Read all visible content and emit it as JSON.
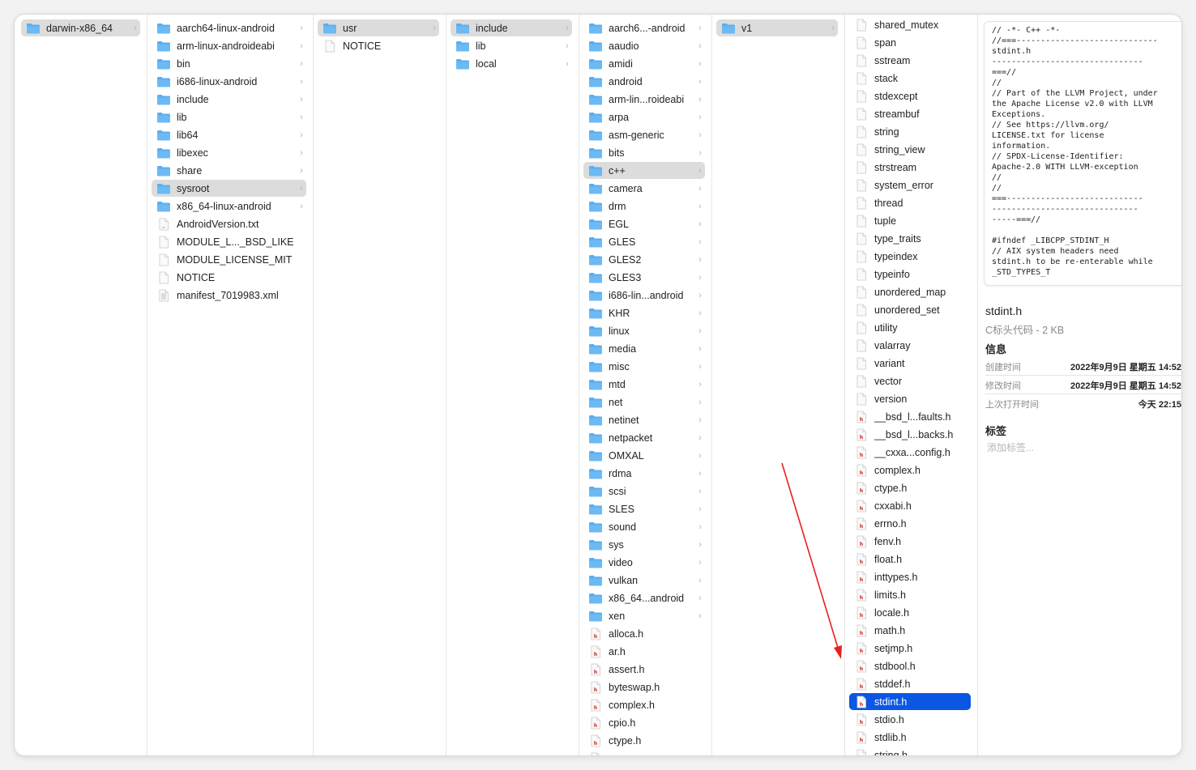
{
  "colors": {
    "selection_active": "#0b57e3",
    "selection_inactive": "#dcdcdc",
    "folder": "#5aaef0",
    "arrow": "#e8201c"
  },
  "columns": [
    {
      "items": [
        {
          "name": "darwin-x86_64",
          "type": "folder",
          "chevron": true,
          "selected": "gray"
        }
      ]
    },
    {
      "items": [
        {
          "name": "aarch64-linux-android",
          "type": "folder",
          "chevron": true
        },
        {
          "name": "arm-linux-androideabi",
          "type": "folder",
          "chevron": true
        },
        {
          "name": "bin",
          "type": "folder",
          "chevron": true
        },
        {
          "name": "i686-linux-android",
          "type": "folder",
          "chevron": true
        },
        {
          "name": "include",
          "type": "folder",
          "chevron": true
        },
        {
          "name": "lib",
          "type": "folder",
          "chevron": true
        },
        {
          "name": "lib64",
          "type": "folder",
          "chevron": true
        },
        {
          "name": "libexec",
          "type": "folder",
          "chevron": true
        },
        {
          "name": "share",
          "type": "folder",
          "chevron": true
        },
        {
          "name": "sysroot",
          "type": "folder",
          "chevron": true,
          "selected": "gray"
        },
        {
          "name": "x86_64-linux-android",
          "type": "folder",
          "chevron": true
        },
        {
          "name": "AndroidVersion.txt",
          "type": "txt"
        },
        {
          "name": "MODULE_L..._BSD_LIKE",
          "type": "file"
        },
        {
          "name": "MODULE_LICENSE_MIT",
          "type": "file"
        },
        {
          "name": "NOTICE",
          "type": "file"
        },
        {
          "name": "manifest_7019983.xml",
          "type": "xml"
        }
      ]
    },
    {
      "items": [
        {
          "name": "usr",
          "type": "folder",
          "chevron": true,
          "selected": "gray"
        },
        {
          "name": "NOTICE",
          "type": "file"
        }
      ]
    },
    {
      "items": [
        {
          "name": "include",
          "type": "folder",
          "chevron": true,
          "selected": "gray"
        },
        {
          "name": "lib",
          "type": "folder",
          "chevron": true
        },
        {
          "name": "local",
          "type": "folder",
          "chevron": true
        }
      ]
    },
    {
      "items": [
        {
          "name": "aarch6...-android",
          "type": "folder",
          "chevron": true
        },
        {
          "name": "aaudio",
          "type": "folder",
          "chevron": true
        },
        {
          "name": "amidi",
          "type": "folder",
          "chevron": true
        },
        {
          "name": "android",
          "type": "folder",
          "chevron": true
        },
        {
          "name": "arm-lin...roideabi",
          "type": "folder",
          "chevron": true
        },
        {
          "name": "arpa",
          "type": "folder",
          "chevron": true
        },
        {
          "name": "asm-generic",
          "type": "folder",
          "chevron": true
        },
        {
          "name": "bits",
          "type": "folder",
          "chevron": true
        },
        {
          "name": "c++",
          "type": "folder",
          "chevron": true,
          "selected": "gray"
        },
        {
          "name": "camera",
          "type": "folder",
          "chevron": true
        },
        {
          "name": "drm",
          "type": "folder",
          "chevron": true
        },
        {
          "name": "EGL",
          "type": "folder",
          "chevron": true
        },
        {
          "name": "GLES",
          "type": "folder",
          "chevron": true
        },
        {
          "name": "GLES2",
          "type": "folder",
          "chevron": true
        },
        {
          "name": "GLES3",
          "type": "folder",
          "chevron": true
        },
        {
          "name": "i686-lin...android",
          "type": "folder",
          "chevron": true
        },
        {
          "name": "KHR",
          "type": "folder",
          "chevron": true
        },
        {
          "name": "linux",
          "type": "folder",
          "chevron": true
        },
        {
          "name": "media",
          "type": "folder",
          "chevron": true
        },
        {
          "name": "misc",
          "type": "folder",
          "chevron": true
        },
        {
          "name": "mtd",
          "type": "folder",
          "chevron": true
        },
        {
          "name": "net",
          "type": "folder",
          "chevron": true
        },
        {
          "name": "netinet",
          "type": "folder",
          "chevron": true
        },
        {
          "name": "netpacket",
          "type": "folder",
          "chevron": true
        },
        {
          "name": "OMXAL",
          "type": "folder",
          "chevron": true
        },
        {
          "name": "rdma",
          "type": "folder",
          "chevron": true
        },
        {
          "name": "scsi",
          "type": "folder",
          "chevron": true
        },
        {
          "name": "SLES",
          "type": "folder",
          "chevron": true
        },
        {
          "name": "sound",
          "type": "folder",
          "chevron": true
        },
        {
          "name": "sys",
          "type": "folder",
          "chevron": true
        },
        {
          "name": "video",
          "type": "folder",
          "chevron": true
        },
        {
          "name": "vulkan",
          "type": "folder",
          "chevron": true
        },
        {
          "name": "x86_64...android",
          "type": "folder",
          "chevron": true
        },
        {
          "name": "xen",
          "type": "folder",
          "chevron": true
        },
        {
          "name": "alloca.h",
          "type": "header"
        },
        {
          "name": "ar.h",
          "type": "header"
        },
        {
          "name": "assert.h",
          "type": "header"
        },
        {
          "name": "byteswap.h",
          "type": "header"
        },
        {
          "name": "complex.h",
          "type": "header"
        },
        {
          "name": "cpio.h",
          "type": "header"
        },
        {
          "name": "ctype.h",
          "type": "header"
        },
        {
          "name": "",
          "type": "header"
        }
      ]
    },
    {
      "items": [
        {
          "name": "v1",
          "type": "folder",
          "chevron": true,
          "selected": "gray"
        }
      ]
    },
    {
      "items": [
        {
          "name": "shared_mutex",
          "type": "file"
        },
        {
          "name": "span",
          "type": "file"
        },
        {
          "name": "sstream",
          "type": "file"
        },
        {
          "name": "stack",
          "type": "file"
        },
        {
          "name": "stdexcept",
          "type": "file"
        },
        {
          "name": "streambuf",
          "type": "file"
        },
        {
          "name": "string",
          "type": "file"
        },
        {
          "name": "string_view",
          "type": "file"
        },
        {
          "name": "strstream",
          "type": "file"
        },
        {
          "name": "system_error",
          "type": "file"
        },
        {
          "name": "thread",
          "type": "file"
        },
        {
          "name": "tuple",
          "type": "file"
        },
        {
          "name": "type_traits",
          "type": "file"
        },
        {
          "name": "typeindex",
          "type": "file"
        },
        {
          "name": "typeinfo",
          "type": "file"
        },
        {
          "name": "unordered_map",
          "type": "file"
        },
        {
          "name": "unordered_set",
          "type": "file"
        },
        {
          "name": "utility",
          "type": "file"
        },
        {
          "name": "valarray",
          "type": "file"
        },
        {
          "name": "variant",
          "type": "file"
        },
        {
          "name": "vector",
          "type": "file"
        },
        {
          "name": "version",
          "type": "file"
        },
        {
          "name": "__bsd_l...faults.h",
          "type": "header"
        },
        {
          "name": "__bsd_l...backs.h",
          "type": "header"
        },
        {
          "name": "__cxxa...config.h",
          "type": "header"
        },
        {
          "name": "complex.h",
          "type": "header"
        },
        {
          "name": "ctype.h",
          "type": "header"
        },
        {
          "name": "cxxabi.h",
          "type": "header"
        },
        {
          "name": "errno.h",
          "type": "header"
        },
        {
          "name": "fenv.h",
          "type": "header"
        },
        {
          "name": "float.h",
          "type": "header"
        },
        {
          "name": "inttypes.h",
          "type": "header"
        },
        {
          "name": "limits.h",
          "type": "header"
        },
        {
          "name": "locale.h",
          "type": "header"
        },
        {
          "name": "math.h",
          "type": "header"
        },
        {
          "name": "setjmp.h",
          "type": "header"
        },
        {
          "name": "stdbool.h",
          "type": "header"
        },
        {
          "name": "stddef.h",
          "type": "header"
        },
        {
          "name": "stdint.h",
          "type": "header",
          "selected": "blue"
        },
        {
          "name": "stdio.h",
          "type": "header"
        },
        {
          "name": "stdlib.h",
          "type": "header"
        },
        {
          "name": "string.h",
          "type": "header"
        }
      ]
    }
  ],
  "preview": {
    "code": "// -*- C++ -*-\n//===-----------------------------\nstdint.h\n-------------------------------\n===//\n//\n// Part of the LLVM Project, under\nthe Apache License v2.0 with LLVM\nExceptions.\n// See https://llvm.org/\nLICENSE.txt for license\ninformation.\n// SPDX-License-Identifier:\nApache-2.0 WITH LLVM-exception\n//\n//\n===----------------------------\n------------------------------\n-----===//\n\n#ifndef _LIBCPP_STDINT_H\n// AIX system headers need\nstdint.h to be re-enterable while\n_STD_TYPES_T",
    "file_name": "stdint.h",
    "file_kind": "C标头代码 - 2 KB",
    "info_heading": "信息",
    "info": [
      {
        "label": "创建时间",
        "value": "2022年9月9日 星期五 14:52"
      },
      {
        "label": "修改时间",
        "value": "2022年9月9日 星期五 14:52"
      },
      {
        "label": "上次打开时间",
        "value": "今天 22:15"
      }
    ],
    "tags_heading": "标签",
    "tags_placeholder": "添加标签..."
  }
}
